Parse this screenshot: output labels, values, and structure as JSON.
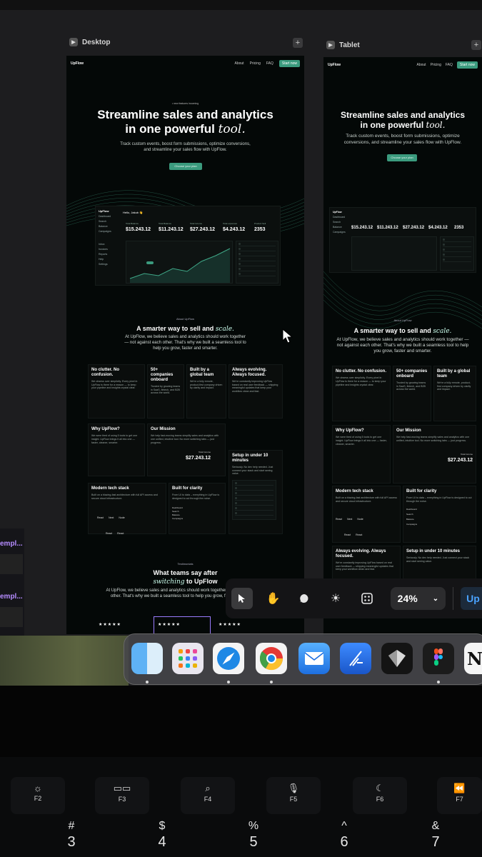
{
  "frames": [
    {
      "title": "Desktop"
    },
    {
      "title": "Tablet"
    }
  ],
  "site": {
    "logo": "UpFlow",
    "nav_links": [
      "About",
      "Pricing",
      "FAQ"
    ],
    "nav_cta": "Start now",
    "badge": "• new features incoming",
    "hero_title_line1": "Streamline sales and analytics",
    "hero_title_line2_plain": "in one powerful",
    "hero_title_line2_em": "tool.",
    "hero_sub": "Track custom events, boost form submissions, optimize conversions, and streamline your sales flow with UpFlow.",
    "hero_cta": "Choose your plan",
    "dashboard": {
      "logo": "UpFlow",
      "greeting": "Hello, Jakub 👋",
      "side_items": [
        "Dashboard",
        "Search",
        "Balance",
        "Campaigns"
      ],
      "side_items2": [
        "Inbox",
        "Invoices",
        "Reports",
        "Help",
        "Settings"
      ],
      "stats": [
        {
          "label": "Total Balance",
          "value": "$15.243.12"
        },
        {
          "label": "Total Balance",
          "value": "$11.243.12"
        },
        {
          "label": "Total Income",
          "value": "$27.243.12"
        },
        {
          "label": "Total expenses",
          "value": "$4.243.12"
        },
        {
          "label": "Product Sell",
          "value": "2353"
        }
      ],
      "tablet_stats": [
        "$15.243.12",
        "$11.243.12",
        "$27.243.12",
        "$4.243.12",
        "2353"
      ]
    },
    "about_eyebrow": "About UpFlow",
    "about_title_plain": "A smarter way to sell and",
    "about_title_em": "scale.",
    "about_text": "At UpFlow, we believe sales and analytics should work together — not against each other. That's why we built a seamless tool to help you grow, faster and smarter.",
    "features": {
      "no_clutter_title": "No clutter. No confusion.",
      "no_clutter_text": "We obsess over simplicity. Every pixel in UpFlow is there for a reason — to keep your pipeline and insights crystal clear.",
      "companies_title": "50+ companies onboard",
      "companies_text": "Trusted by growing teams in SaaS, fintech, and B2B across the world.",
      "global_title": "Built by a global team",
      "global_text": "We're a fully remote, product-first company driven by clarity and impact.",
      "evolving_title": "Always evolving. Always focused.",
      "evolving_text": "We're constantly improving UpFlow based on real user feedback — shipping meaningful updates that keep your workflow clean and fast.",
      "why_title": "Why UpFlow?",
      "why_text": "We were tired of using 5 tools to get one insight. UpFlow brings it all into one — faster, cleaner, smarter.",
      "mission_title": "Our Mission",
      "mission_text": "We help fast-moving teams simplify sales and analytics with one unified, intuitive tool. No more switching tabs — just progress.",
      "mission_stat_label": "Total Income",
      "mission_stat_value": "$27.243.12",
      "setup_title": "Setup in under 10 minutes",
      "setup_text": "Seriously. No dev help needed. Just connect your stack and start seeing value.",
      "tech_title": "Modern tech stack",
      "tech_text": "Built on a blazing-fast architecture with full API access and secure cloud infrastructure.",
      "tech_tags": [
        "React",
        "Next",
        "Node",
        "React",
        "React"
      ],
      "clarity_title": "Built for clarity",
      "clarity_text": "From UI to data – everything in UpFlow is designed to cut through the noise.",
      "clarity_items": [
        "Dashboard",
        "Search",
        "Balance",
        "Campaigns"
      ]
    },
    "testimonials_eyebrow": "Testimonials",
    "testimonials_title_plain": "What teams say after",
    "testimonials_title_em": "switching",
    "testimonials_title_tail": "to UpFlow",
    "testimonials_text": "At UpFlow, we believe sales and analytics should work together — not against each other. That's why we built a seamless tool to help you grow, faster and smarter.",
    "stars": "★★★★★"
  },
  "left_panel": {
    "label1": "empl...",
    "label2": "empl..."
  },
  "toolbar": {
    "zoom": "24%",
    "right_label": "Up",
    "icons": [
      "cursor-icon",
      "hand-icon",
      "comment-icon",
      "sun-icon",
      "components-icon"
    ]
  },
  "dock": {
    "apps": [
      "Finder",
      "Launchpad",
      "Safari",
      "Chrome",
      "Mail",
      "Xcode",
      "Screen Studio",
      "Figma",
      "Notion"
    ]
  },
  "keyboard": {
    "fkeys": [
      {
        "label": "F2",
        "icon": "brightness-icon"
      },
      {
        "label": "F3",
        "icon": "mission-control-icon"
      },
      {
        "label": "F4",
        "icon": "search-icon"
      },
      {
        "label": "F5",
        "icon": "mic-icon"
      },
      {
        "label": "F6",
        "icon": "moon-icon"
      },
      {
        "label": "F7",
        "icon": "rewind-icon"
      }
    ],
    "numkeys": [
      {
        "sym": "#",
        "num": "3"
      },
      {
        "sym": "$",
        "num": "4"
      },
      {
        "sym": "%",
        "num": "5"
      },
      {
        "sym": "^",
        "num": "6"
      },
      {
        "sym": "&",
        "num": "7"
      }
    ]
  }
}
